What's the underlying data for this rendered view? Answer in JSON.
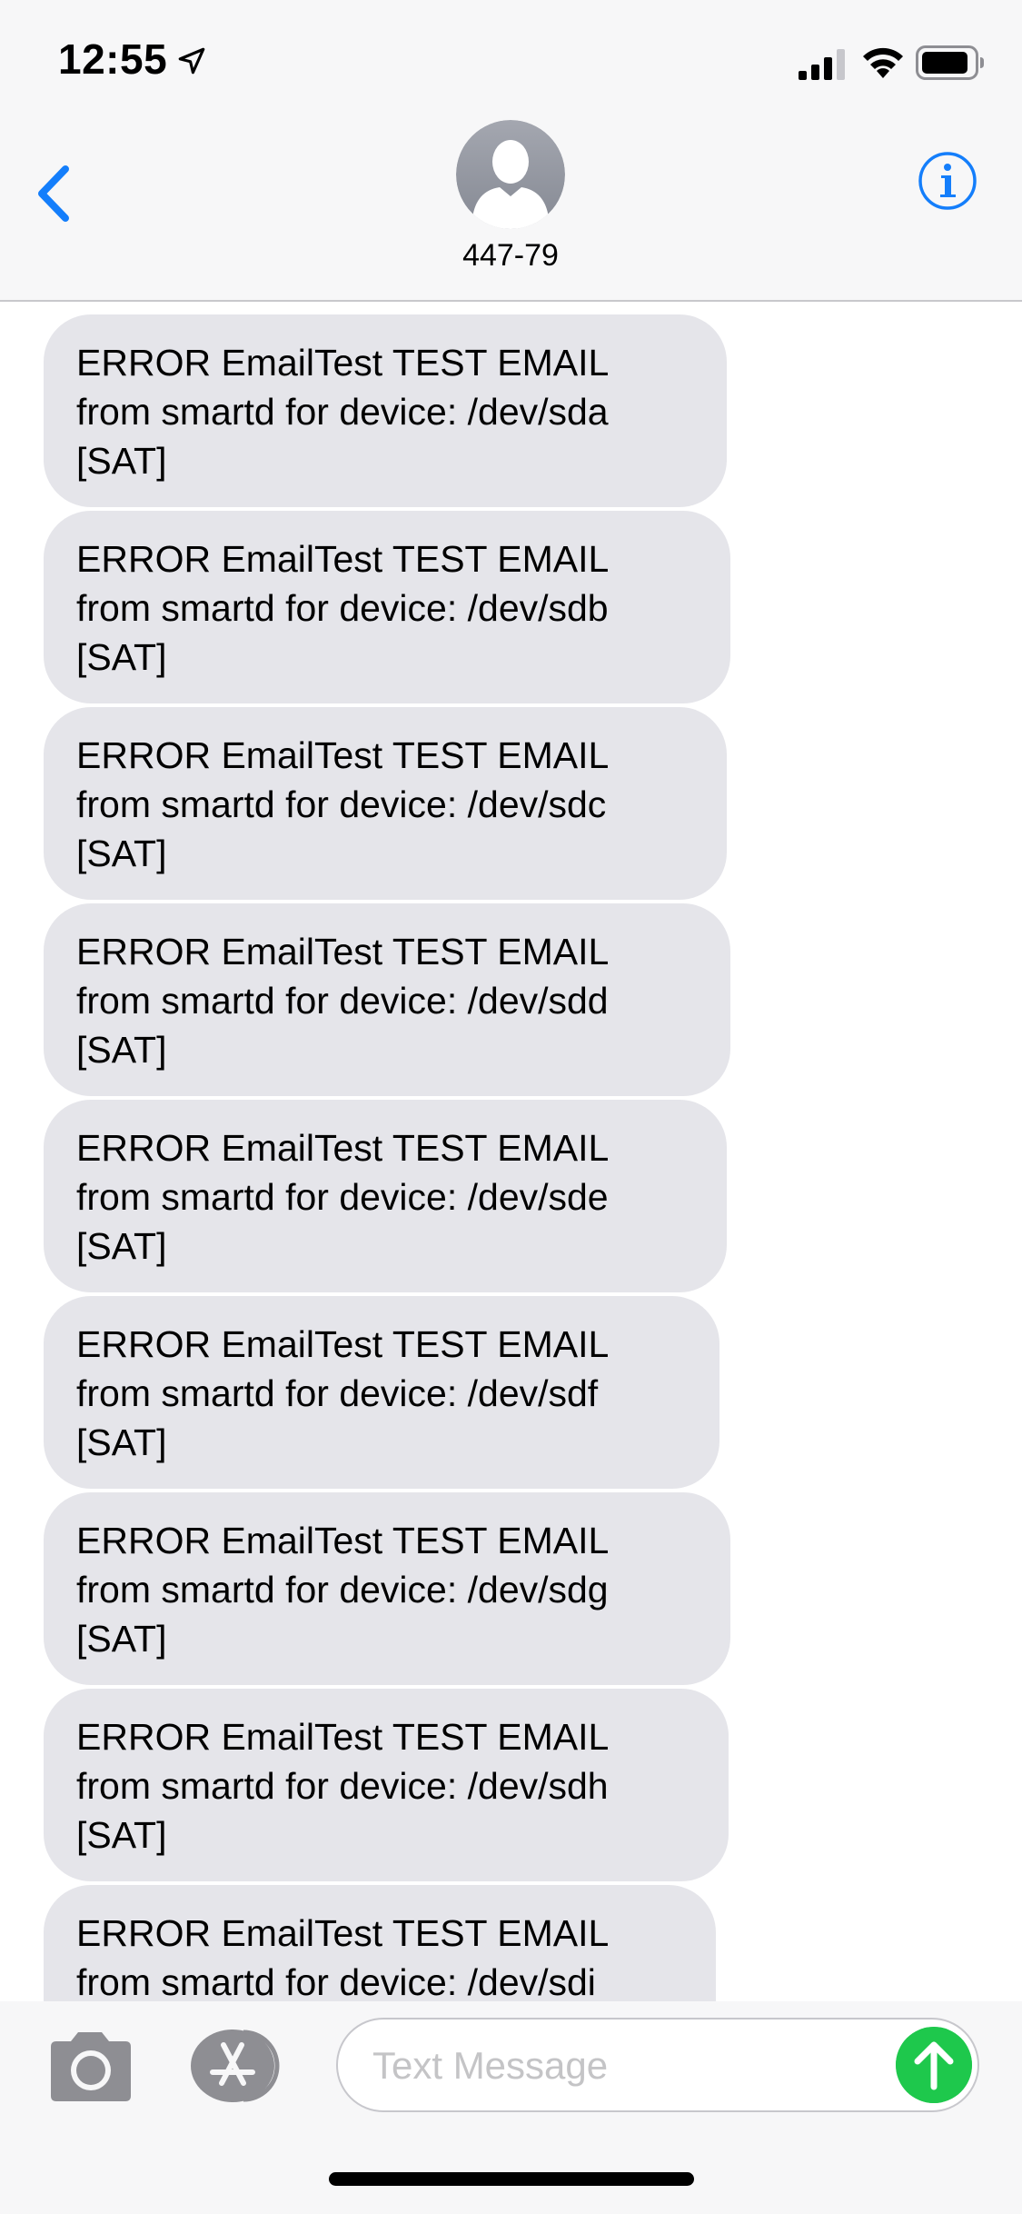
{
  "status_bar": {
    "time": "12:55"
  },
  "header": {
    "contact_name": "447-79"
  },
  "messages": [
    {
      "text": "ERROR EmailTest TEST EMAIL\nfrom smartd for device: /dev/sda\n[SAT]"
    },
    {
      "text": "ERROR EmailTest TEST EMAIL\nfrom smartd for device: /dev/sdb\n[SAT]"
    },
    {
      "text": "ERROR EmailTest TEST EMAIL\nfrom smartd for device: /dev/sdc\n[SAT]"
    },
    {
      "text": "ERROR EmailTest TEST EMAIL\nfrom smartd for device: /dev/sdd\n[SAT]"
    },
    {
      "text": "ERROR EmailTest TEST EMAIL\nfrom smartd for device: /dev/sde\n[SAT]"
    },
    {
      "text": "ERROR EmailTest TEST EMAIL\nfrom smartd for device: /dev/sdf\n[SAT]"
    },
    {
      "text": "ERROR EmailTest TEST EMAIL\nfrom smartd for device: /dev/sdg\n[SAT]"
    },
    {
      "text": "ERROR EmailTest TEST EMAIL\nfrom smartd for device: /dev/sdh\n[SAT]"
    },
    {
      "text": "ERROR EmailTest TEST EMAIL\nfrom smartd for device: /dev/sdi"
    }
  ],
  "composer": {
    "placeholder": "Text Message",
    "value": ""
  },
  "icons": {
    "location": "location-arrow-icon",
    "signal": "cellular-signal-icon",
    "wifi": "wifi-icon",
    "battery": "battery-icon",
    "back": "chevron-left-icon",
    "avatar": "person-silhouette-icon",
    "info": "info-icon",
    "camera": "camera-icon",
    "appstore": "app-store-icon",
    "send": "arrow-up-icon"
  },
  "colors": {
    "accent_blue": "#147efb",
    "bubble_gray": "#e5e5ea",
    "send_green": "#1ec84c",
    "bar_background": "#f7f7f8"
  }
}
